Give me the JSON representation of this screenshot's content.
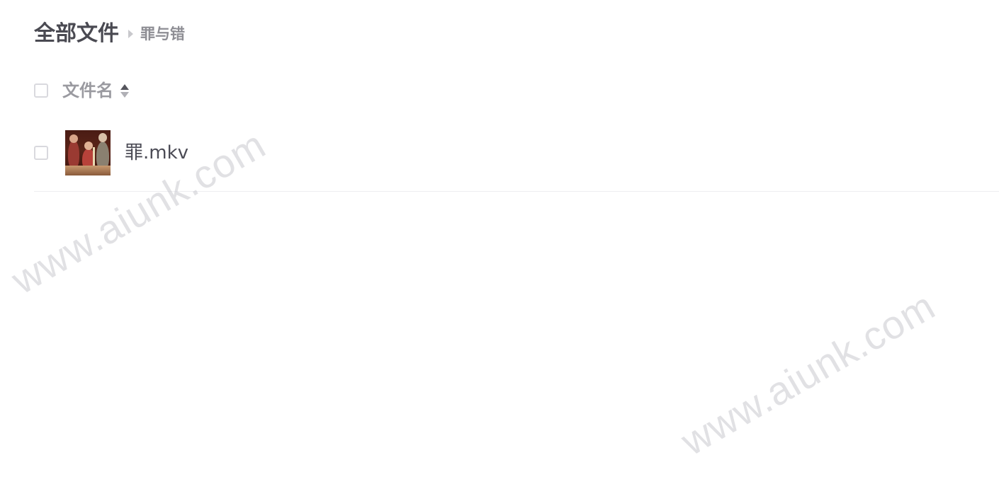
{
  "breadcrumb": {
    "root": "全部文件",
    "current": "罪与错"
  },
  "list_header": {
    "column_title": "文件名"
  },
  "files": [
    {
      "name": "罪.mkv",
      "thumbnail": "video-thumbnail"
    }
  ],
  "watermark": {
    "text": "www.aiunk.com"
  }
}
